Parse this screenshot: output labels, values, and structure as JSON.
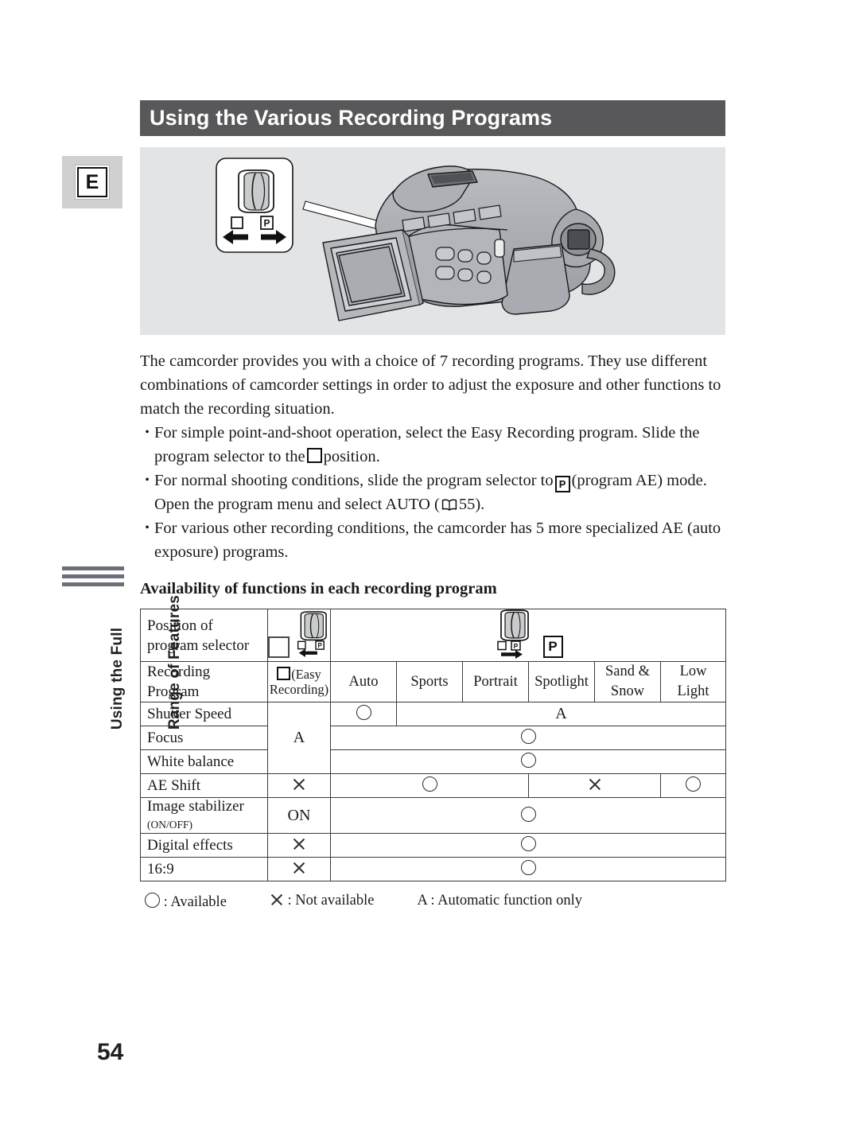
{
  "page": {
    "number": "54",
    "language_tab": "E",
    "running_head_line1": "Using the Full",
    "running_head_line2": "Range of Features"
  },
  "header": {
    "title": "Using the Various Recording Programs"
  },
  "illustration": {
    "name": "camcorder-program-selector-illustration",
    "callout_icons": {
      "square_label": "",
      "p_label": "P"
    }
  },
  "body": {
    "intro": "The camcorder provides you with a choice of 7 recording programs. They use different combinations of camcorder settings in order to adjust the exposure and other functions to match the recording situation.",
    "bullets": [
      {
        "pre": "For simple point-and-shoot operation, select the Easy Recording program. Slide the program selector to the",
        "icon": "square-icon",
        "post": "position."
      },
      {
        "pre": "For normal shooting conditions, slide the program selector to",
        "icon": "p-icon",
        "mid": "(program AE) mode. Open the program menu and select AUTO (",
        "ref_icon": "book-icon",
        "ref_page": "55",
        "post": ")."
      },
      {
        "pre": "For various other recording conditions, the camcorder has 5 more specialized AE (auto exposure) programs.",
        "icon": "",
        "post": ""
      }
    ]
  },
  "section": {
    "heading": "Availability of functions in each recording program"
  },
  "table": {
    "row_header_1": "Position of\nprogram selector",
    "row_header_1_line1": "Position of",
    "row_header_1_line2": "program selector",
    "row_header_2_line1": "Recording",
    "row_header_2_line2": "Program",
    "selector_left_p": "P",
    "selector_right_p": "P",
    "programs": [
      {
        "label_line1": "(Easy",
        "label_line2": "Recording)",
        "has_square_icon": true
      },
      {
        "label_line1": "Auto",
        "label_line2": ""
      },
      {
        "label_line1": "Sports",
        "label_line2": ""
      },
      {
        "label_line1": "Portrait",
        "label_line2": ""
      },
      {
        "label_line1": "Spotlight",
        "label_line2": ""
      },
      {
        "label_line1": "Sand &",
        "label_line2": "Snow"
      },
      {
        "label_line1": "Low",
        "label_line2": "Light"
      }
    ],
    "rows": [
      {
        "label": "Shutter Speed",
        "label_small": ""
      },
      {
        "label": "Focus",
        "label_small": ""
      },
      {
        "label": "White balance",
        "label_small": ""
      },
      {
        "label": "AE Shift",
        "label_small": ""
      },
      {
        "label": "Image stabilizer ",
        "label_small": "(ON/OFF)"
      },
      {
        "label": "Digital effects",
        "label_small": ""
      },
      {
        "label": "16:9",
        "label_small": ""
      }
    ],
    "values": {
      "shutter_easy": "A",
      "shutter_auto": "circle",
      "shutter_rest": "A",
      "focus_rest": "circle",
      "white_balance_rest": "circle",
      "ae_shift_easy": "cross",
      "ae_shift_auto_portrait": "circle",
      "ae_shift_spotlight_sand": "cross",
      "ae_shift_lowlight": "circle",
      "stabilizer_easy": "ON",
      "stabilizer_rest": "circle",
      "digital_effects_easy": "cross",
      "digital_effects_rest": "circle",
      "wide_easy": "cross",
      "wide_rest": "circle"
    }
  },
  "legend": [
    {
      "symbol": "circle",
      "text": ": Available"
    },
    {
      "symbol": "cross",
      "text": ": Not available"
    },
    {
      "symbol": "A",
      "text": ": Automatic function only"
    }
  ],
  "colors": {
    "title_bar": "#58585a",
    "illustration_bg": "#e3e4e6",
    "tab_bg": "#d0d0d0",
    "rule_bar": "#6b6f7a"
  }
}
